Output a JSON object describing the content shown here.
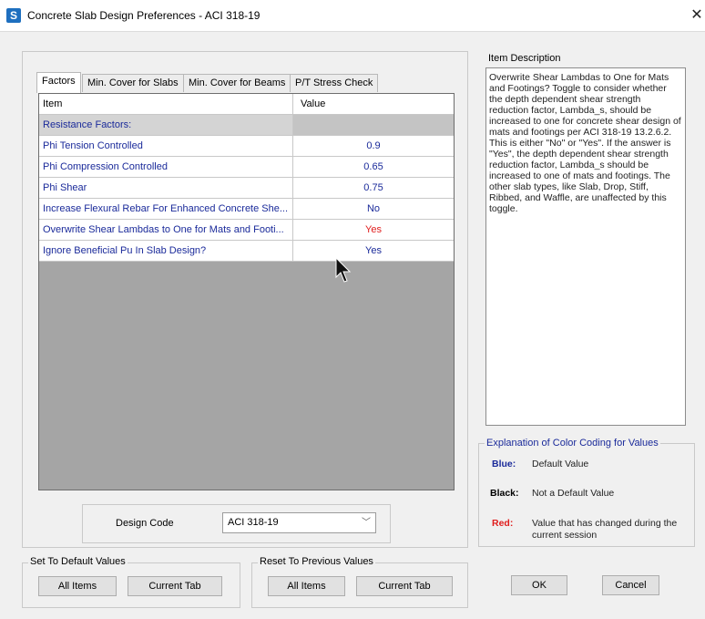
{
  "window": {
    "title": "Concrete Slab Design Preferences - ACI 318-19",
    "app_icon_letter": "S",
    "close_glyph": "✕"
  },
  "tabs": [
    {
      "label": "Factors",
      "active": true
    },
    {
      "label": "Min. Cover for Slabs",
      "active": false
    },
    {
      "label": "Min. Cover for Beams",
      "active": false
    },
    {
      "label": "P/T Stress Check",
      "active": false
    }
  ],
  "grid": {
    "headers": {
      "item": "Item",
      "value": "Value"
    },
    "rows": [
      {
        "item": "Resistance Factors:",
        "value": "",
        "section": true
      },
      {
        "item": "Phi Tension Controlled",
        "value": "0.9"
      },
      {
        "item": "Phi Compression Controlled",
        "value": "0.65"
      },
      {
        "item": "Phi Shear",
        "value": "0.75"
      },
      {
        "item": "Increase Flexural Rebar For Enhanced Concrete She...",
        "value": "No"
      },
      {
        "item": "Overwrite Shear Lambdas to One for Mats and Footi...",
        "value": "Yes",
        "changed": true
      },
      {
        "item": "Ignore Beneficial Pu In Slab Design?",
        "value": "Yes"
      }
    ]
  },
  "item_description": {
    "label": "Item Description",
    "text": "Overwrite Shear Lambdas to One for Mats and Footings?  Toggle to consider whether the depth dependent shear strength reduction factor, Lambda_s, should be increased to one for concrete shear design of mats and footings per ACI 318-19 13.2.6.2.  This is either \"No\" or \"Yes\".  If the answer is \"Yes\", the depth dependent shear strength reduction factor, Lambda_s should be increased to one of mats and footings.  The other slab types, like Slab, Drop, Stiff, Ribbed, and Waffle, are unaffected by this toggle."
  },
  "color_legend": {
    "label": "Explanation of Color Coding for Values",
    "entries": [
      {
        "key": "Blue:",
        "text": "Default Value",
        "color": "#1a2a9a"
      },
      {
        "key": "Black:",
        "text": "Not a Default Value",
        "color": "#000000"
      },
      {
        "key": "Red:",
        "text": "Value that has changed during the current session",
        "color": "#e01d1d"
      }
    ]
  },
  "design_code": {
    "label": "Design Code",
    "value": "ACI 318-19"
  },
  "set_default": {
    "label": "Set To Default Values",
    "all_items": "All Items",
    "current_tab": "Current Tab"
  },
  "reset_previous": {
    "label": "Reset To Previous Values",
    "all_items": "All Items",
    "current_tab": "Current Tab"
  },
  "dialog_buttons": {
    "ok": "OK",
    "cancel": "Cancel"
  }
}
